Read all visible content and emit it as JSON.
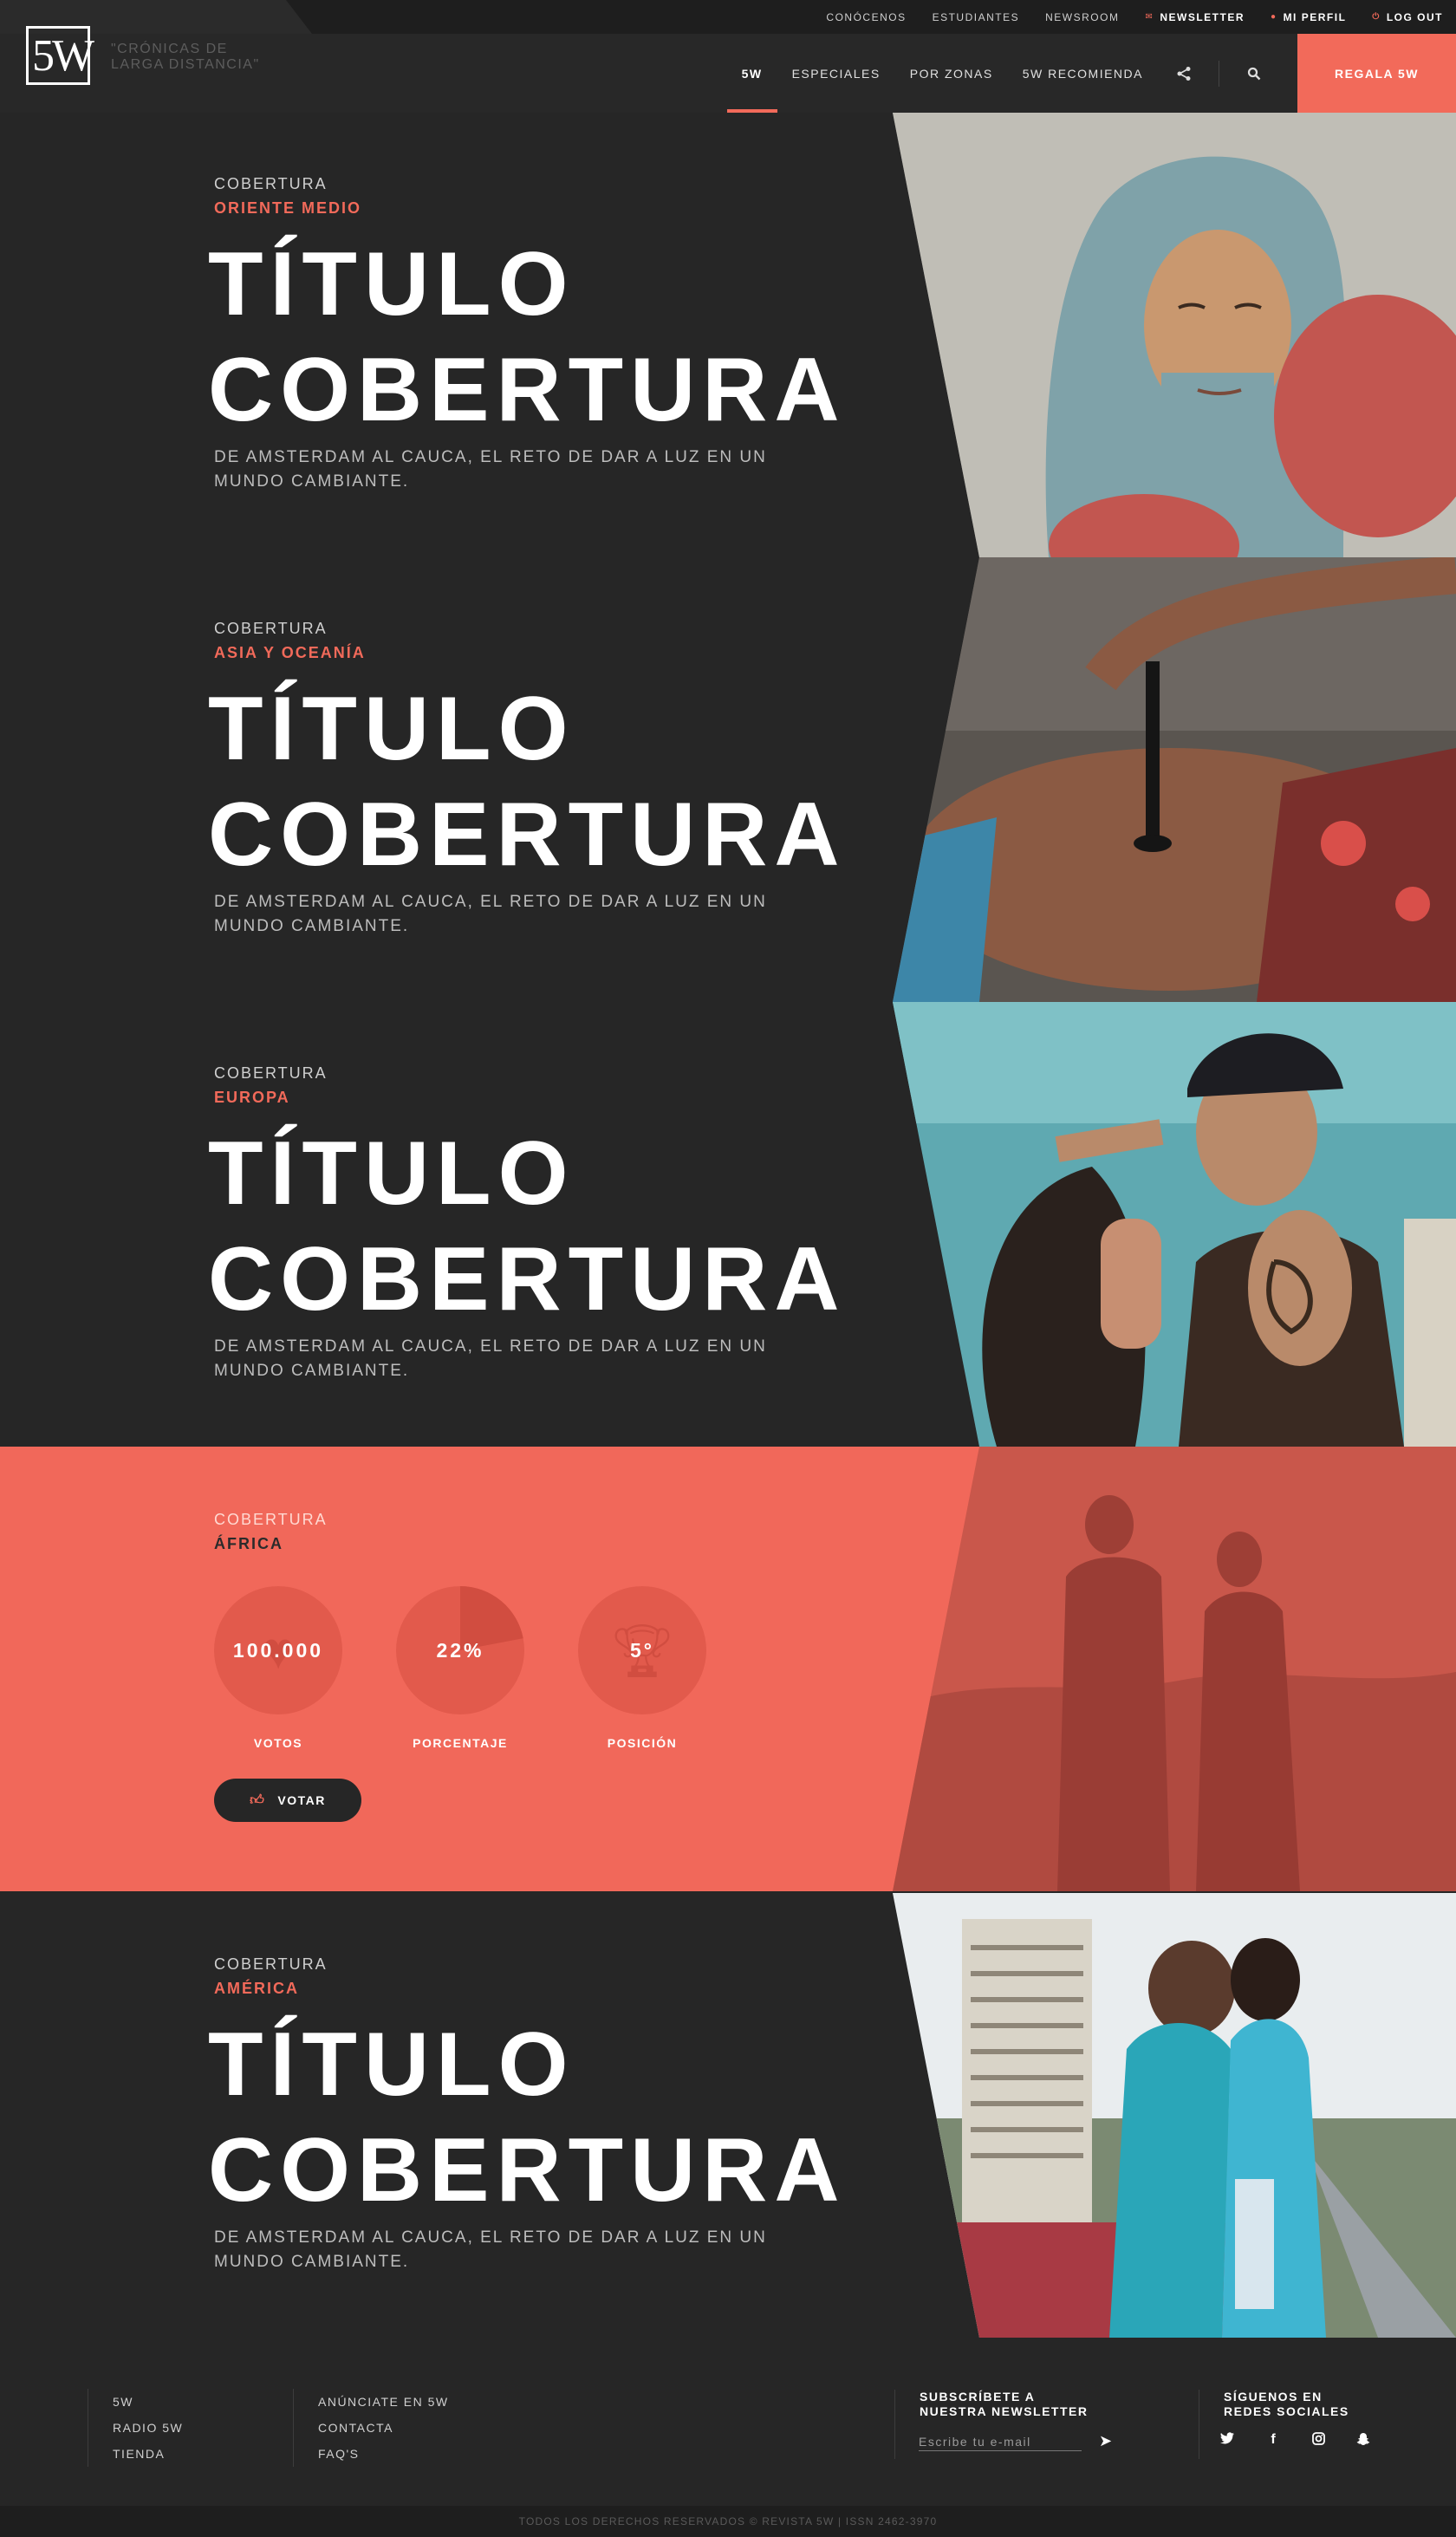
{
  "topbar": {
    "links": [
      {
        "label": "CONÓCENOS"
      },
      {
        "label": "ESTUDIANTES"
      },
      {
        "label": "NEWSROOM"
      },
      {
        "label": "NEWSLETTER",
        "icon": "envelope-icon"
      },
      {
        "label": "MI PERFIL",
        "icon": "user-icon"
      },
      {
        "label": "LOG OUT",
        "icon": "power-icon"
      }
    ]
  },
  "header": {
    "logo": "5W",
    "tagline": "\"CRÓNICAS DE LARGA DISTANCIA\"",
    "nav": [
      {
        "label": "5W"
      },
      {
        "label": "ESPECIALES"
      },
      {
        "label": "POR ZONAS"
      },
      {
        "label": "5W  RECOMIENDA"
      }
    ],
    "share_icon": "share-icon",
    "search_icon": "search-icon",
    "cta": "REGALA 5W"
  },
  "sections": [
    {
      "eyebrow": "COBERTURA",
      "zone": "ORIENTE MEDIO",
      "title_line1": "TÍTULO",
      "title_line2": "COBERTURA",
      "desc_line1": "DE AMSTERDAM AL CAUCA, EL RETO DE DAR A LUZ EN UN",
      "desc_line2": "MUNDO CAMBIANTE."
    },
    {
      "eyebrow": "COBERTURA",
      "zone": "ASIA Y OCEANÍA",
      "title_line1": "TÍTULO",
      "title_line2": "COBERTURA",
      "desc_line1": "DE AMSTERDAM AL CAUCA, EL RETO DE DAR A LUZ EN UN",
      "desc_line2": "MUNDO CAMBIANTE."
    },
    {
      "eyebrow": "COBERTURA",
      "zone": "EUROPA",
      "title_line1": "TÍTULO",
      "title_line2": "COBERTURA",
      "desc_line1": "DE AMSTERDAM AL CAUCA, EL RETO DE DAR A LUZ EN UN",
      "desc_line2": "MUNDO CAMBIANTE."
    },
    {
      "eyebrow": "COBERTURA",
      "zone": "ÁFRICA",
      "stats": [
        {
          "value": "100.000",
          "label": "VOTOS",
          "icon": "heart-icon"
        },
        {
          "value": "22%",
          "label": "PORCENTAJE",
          "fraction": 0.22
        },
        {
          "value": "5°",
          "label": "POSICIÓN",
          "icon": "trophy-icon"
        }
      ],
      "vote_label": "VOTAR"
    },
    {
      "eyebrow": "COBERTURA",
      "zone": "AMÉRICA",
      "title_line1": "TÍTULO",
      "title_line2": "COBERTURA",
      "desc_line1": "DE AMSTERDAM AL CAUCA, EL RETO DE DAR A LUZ EN UN",
      "desc_line2": "MUNDO CAMBIANTE."
    }
  ],
  "footer": {
    "col1": [
      "5W",
      "RADIO 5W",
      "TIENDA"
    ],
    "col2": [
      "ANÚNCIATE EN 5W",
      "CONTACTA",
      "FAQ'S"
    ],
    "newsletter_heading_line1": "SUBSCRÍBETE A",
    "newsletter_heading_line2": "NUESTRA NEWSLETTER",
    "newsletter_placeholder": "Escribe tu e-mail",
    "social_heading_line1": "SÍGUENOS EN",
    "social_heading_line2": "REDES SOCIALES",
    "social_icons": [
      "twitter-icon",
      "facebook-icon",
      "instagram-icon",
      "snapchat-icon"
    ],
    "copyright": "TODOS LOS DERECHOS RESERVADOS © REVISTA 5W | ISSN 2462-3970"
  },
  "colors": {
    "accent": "#f26a5a",
    "dark": "#262626",
    "coral_bg": "#f1685a"
  }
}
